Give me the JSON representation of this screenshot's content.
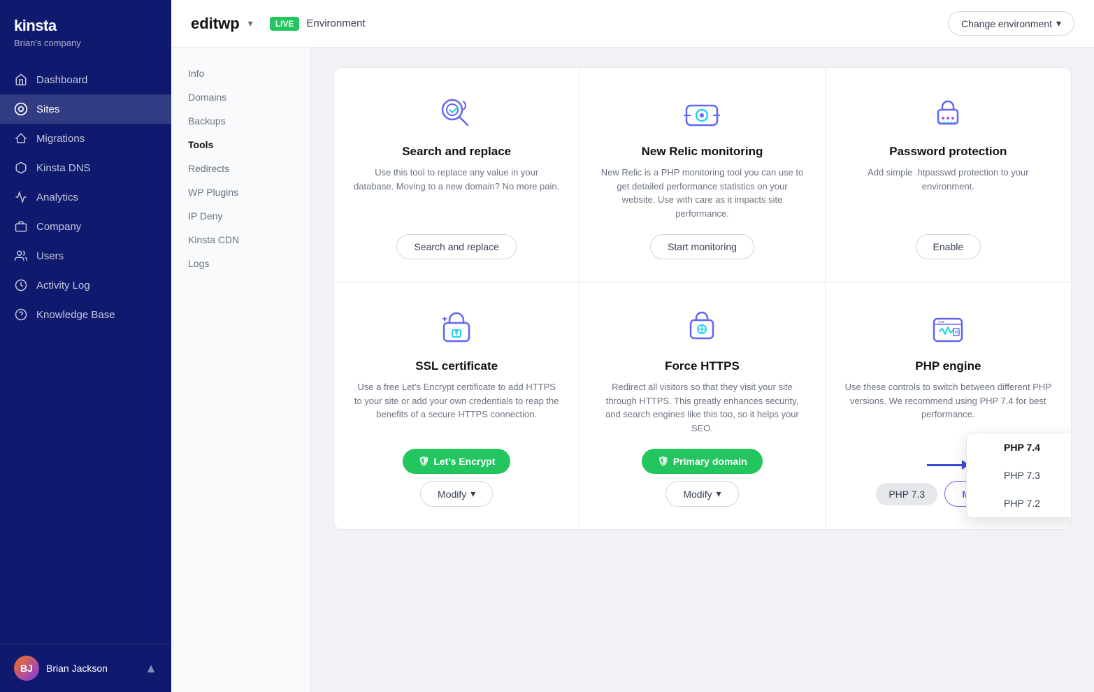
{
  "sidebar": {
    "logo": "kinsta",
    "company": "Brian's company",
    "nav_items": [
      {
        "label": "Dashboard",
        "icon": "home",
        "active": false
      },
      {
        "label": "Sites",
        "icon": "sites",
        "active": true
      },
      {
        "label": "Migrations",
        "icon": "migrations",
        "active": false
      },
      {
        "label": "Kinsta DNS",
        "icon": "dns",
        "active": false
      },
      {
        "label": "Analytics",
        "icon": "analytics",
        "active": false
      },
      {
        "label": "Company",
        "icon": "company",
        "active": false
      },
      {
        "label": "Users",
        "icon": "users",
        "active": false
      },
      {
        "label": "Activity Log",
        "icon": "activity",
        "active": false
      },
      {
        "label": "Knowledge Base",
        "icon": "knowledge",
        "active": false
      }
    ],
    "user": {
      "name": "Brian Jackson",
      "initials": "BJ"
    }
  },
  "topbar": {
    "site_name": "editwp",
    "env_badge": "LIVE",
    "env_label": "Environment",
    "change_env_button": "Change environment"
  },
  "sub_nav": {
    "items": [
      {
        "label": "Info",
        "active": false
      },
      {
        "label": "Domains",
        "active": false
      },
      {
        "label": "Backups",
        "active": false
      },
      {
        "label": "Tools",
        "active": true
      },
      {
        "label": "Redirects",
        "active": false
      },
      {
        "label": "WP Plugins",
        "active": false
      },
      {
        "label": "IP Deny",
        "active": false
      },
      {
        "label": "Kinsta CDN",
        "active": false
      },
      {
        "label": "Logs",
        "active": false
      }
    ]
  },
  "tools": [
    {
      "id": "search-replace",
      "title": "Search and replace",
      "description": "Use this tool to replace any value in your database. Moving to a new domain? No more pain.",
      "actions": [
        {
          "label": "Search and replace",
          "type": "outline",
          "primary": true
        }
      ]
    },
    {
      "id": "new-relic",
      "title": "New Relic monitoring",
      "description": "New Relic is a PHP monitoring tool you can use to get detailed performance statistics on your website. Use with care as it impacts site performance.",
      "actions": [
        {
          "label": "Start monitoring",
          "type": "outline",
          "primary": true
        }
      ]
    },
    {
      "id": "password-protection",
      "title": "Password protection",
      "description": "Add simple .htpasswd protection to your environment.",
      "actions": [
        {
          "label": "Enable",
          "type": "outline",
          "primary": true
        }
      ]
    },
    {
      "id": "ssl-certificate",
      "title": "SSL certificate",
      "description": "Use a free Let's Encrypt certificate to add HTTPS to your site or add your own credentials to reap the benefits of a secure HTTPS connection.",
      "actions": [
        {
          "label": "Let's Encrypt",
          "type": "green",
          "icon": "shield"
        },
        {
          "label": "Modify",
          "type": "outline",
          "has_chevron": true
        }
      ]
    },
    {
      "id": "force-https",
      "title": "Force HTTPS",
      "description": "Redirect all visitors so that they visit your site through HTTPS. This greatly enhances security, and search engines like this too, so it helps your SEO.",
      "actions": [
        {
          "label": "Primary domain",
          "type": "green",
          "icon": "shield"
        },
        {
          "label": "Modify",
          "type": "outline",
          "has_chevron": true
        }
      ]
    },
    {
      "id": "php-engine",
      "title": "PHP engine",
      "description": "Use these controls to switch between different PHP versions. We recommend using PHP 7.4 for best performance.",
      "actions": [
        {
          "label": "PHP 7.3",
          "type": "badge"
        },
        {
          "label": "Modify",
          "type": "outline-selected",
          "has_chevron": true
        }
      ],
      "dropdown": {
        "open": true,
        "options": [
          {
            "label": "PHP 7.4",
            "highlighted": true
          },
          {
            "label": "PHP 7.3",
            "highlighted": false
          },
          {
            "label": "PHP 7.2",
            "highlighted": false
          }
        ]
      }
    }
  ]
}
